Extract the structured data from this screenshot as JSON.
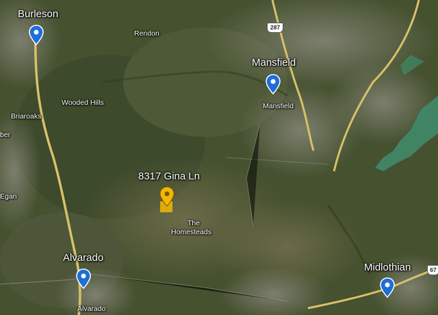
{
  "map": {
    "type": "satellite",
    "colors": {
      "terrain": "#4a5639",
      "highway": "#d9c16a",
      "water": "#3f8a6a",
      "city_pin": "#1d6ed8",
      "address_pin": "#f2b705"
    }
  },
  "places": {
    "burleson": "Burleson",
    "rendon": "Rendon",
    "wooded_hills": "Wooded Hills",
    "briaroaks": "Briaroaks",
    "ber": "ber",
    "egan": "Egan",
    "mansfield_big": "Mansfield",
    "mansfield_small": "Mansfield",
    "address": "8317 Gina Ln",
    "homesteads_1": "The",
    "homesteads_2": "Homesteads",
    "alvarado_big": "Alvarado",
    "alvarado_small": "Alvarado",
    "midlothian": "Midlothian"
  },
  "shields": {
    "us287": "287",
    "us67": "67"
  },
  "markers": {
    "city_icon": "location-pin-icon",
    "address_icon": "location-pin-icon"
  }
}
